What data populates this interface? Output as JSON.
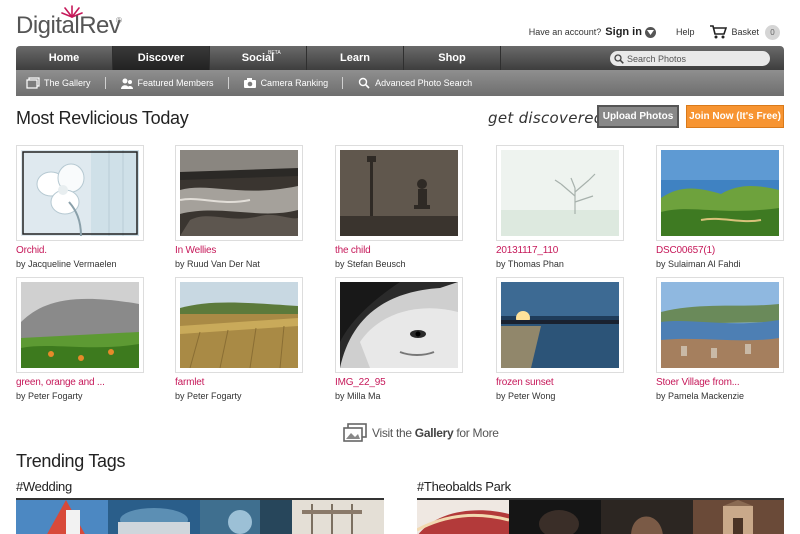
{
  "brand": {
    "name": "DigitalRev",
    "reg": "®"
  },
  "topbar": {
    "question": "Have an account?",
    "signin": "Sign in",
    "help": "Help",
    "basket": "Basket",
    "basket_count": "0"
  },
  "nav": {
    "items": [
      {
        "label": "Home"
      },
      {
        "label": "Discover"
      },
      {
        "label": "Social",
        "tag": "BETA"
      },
      {
        "label": "Learn"
      },
      {
        "label": "Shop"
      }
    ],
    "search_placeholder": "Search Photos"
  },
  "subnav": {
    "items": [
      {
        "label": "The Gallery",
        "icon": "gallery-icon"
      },
      {
        "label": "Featured Members",
        "icon": "members-icon"
      },
      {
        "label": "Camera Ranking",
        "icon": "camera-icon"
      },
      {
        "label": "Advanced Photo Search",
        "icon": "search-icon"
      }
    ]
  },
  "main": {
    "title": "Most Revlicious Today",
    "tagline": "get discovered!",
    "upload_label": "Upload Photos",
    "join_label": "Join Now (It's Free)"
  },
  "photos": [
    {
      "title": "Orchid.",
      "by": "by Jacqueline Vermaelen"
    },
    {
      "title": "In Wellies",
      "by": "by Ruud Van Der Nat"
    },
    {
      "title": "the child",
      "by": "by Stefan Beusch"
    },
    {
      "title": "20131117_110",
      "by": "by Thomas Phan"
    },
    {
      "title": "DSC00657(1)",
      "by": "by Sulaiman Al Fahdi"
    },
    {
      "title": "green, orange and ...",
      "by": "by Peter Fogarty"
    },
    {
      "title": "farmlet",
      "by": "by Peter Fogarty"
    },
    {
      "title": "IMG_22_95",
      "by": "by Milla Ma"
    },
    {
      "title": "frozen sunset",
      "by": "by Peter Wong"
    },
    {
      "title": "Stoer Village from...",
      "by": "by Pamela Mackenzie"
    }
  ],
  "more": {
    "pre": "Visit the",
    "bold": "Gallery",
    "post": "for More"
  },
  "trending": {
    "title": "Trending Tags",
    "tags": [
      {
        "label": "#Wedding"
      },
      {
        "label": "#Theobalds Park"
      }
    ]
  },
  "colors": {
    "accent": "#c6195a",
    "join": "#f79431",
    "nav": "#4a4a4a"
  }
}
